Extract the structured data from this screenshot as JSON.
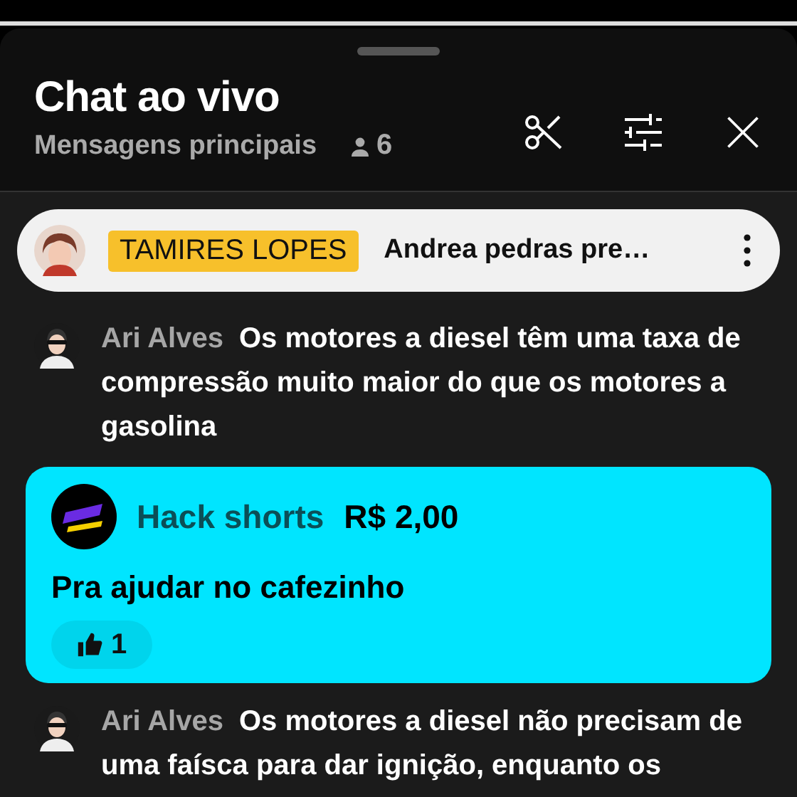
{
  "header": {
    "title": "Chat ao vivo",
    "mode": "Mensagens principais",
    "viewers": "6"
  },
  "pinned": {
    "author": "TAMIRES LOPES",
    "text": "Andrea pedras pre…"
  },
  "messages": [
    {
      "kind": "text",
      "author": "Ari Alves",
      "text": "Os motores a diesel têm uma taxa de compressão muito maior do que os motores a gasolina"
    },
    {
      "kind": "super",
      "author": "Hack shorts",
      "amount": "R$ 2,00",
      "text": "Pra ajudar no cafezinho",
      "likes": "1"
    },
    {
      "kind": "text",
      "author": "Ari Alves",
      "text": "Os motores a diesel não precisam de uma faísca para dar ignição, enquanto os"
    }
  ]
}
